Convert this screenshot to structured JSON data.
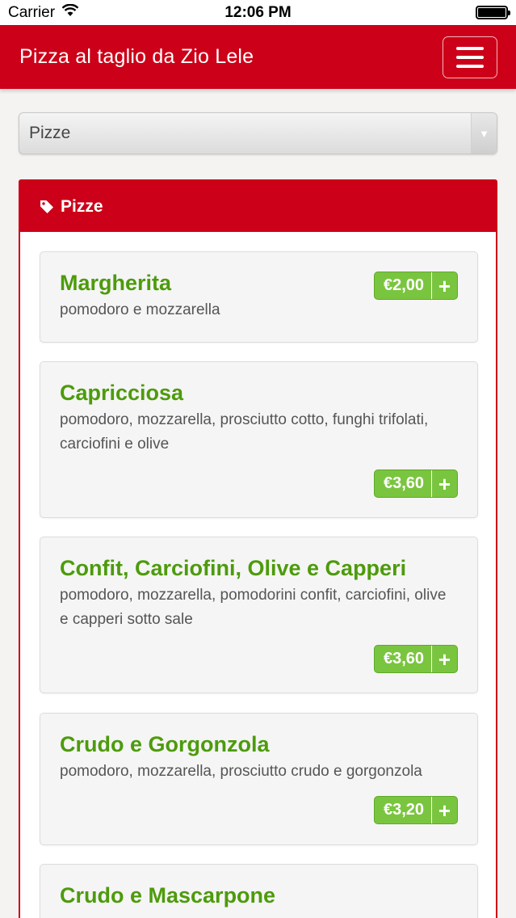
{
  "status_bar": {
    "carrier": "Carrier",
    "time": "12:06 PM"
  },
  "header": {
    "title": "Pizza al taglio da Zio Lele"
  },
  "category_select": {
    "selected": "Pizze"
  },
  "category_panel": {
    "title": "Pizze",
    "products": [
      {
        "name": "Margherita",
        "description": "pomodoro e mozzarella",
        "price": "€2,00"
      },
      {
        "name": "Capricciosa",
        "description": "pomodoro, mozzarella, prosciutto cotto, funghi trifolati, carciofini e olive",
        "price": "€3,60"
      },
      {
        "name": "Confit, Carciofini, Olive e Capperi",
        "description": "pomodoro, mozzarella, pomodorini confit, carciofini, olive e capperi sotto sale",
        "price": "€3,60"
      },
      {
        "name": "Crudo e Gorgonzola",
        "description": "pomodoro, mozzarella, prosciutto crudo e gorgonzola",
        "price": "€3,20"
      },
      {
        "name": "Crudo e Mascarpone",
        "description": "",
        "price": ""
      }
    ]
  },
  "colors": {
    "brand_red": "#cc0018",
    "product_green": "#4d9b0c",
    "price_green": "#7ac53f"
  },
  "icons": {
    "wifi": "wifi-icon",
    "battery": "battery-icon",
    "menu": "hamburger-menu-icon",
    "tag": "tag-icon",
    "plus": "plus-icon",
    "dropdown": "chevron-down-icon"
  }
}
